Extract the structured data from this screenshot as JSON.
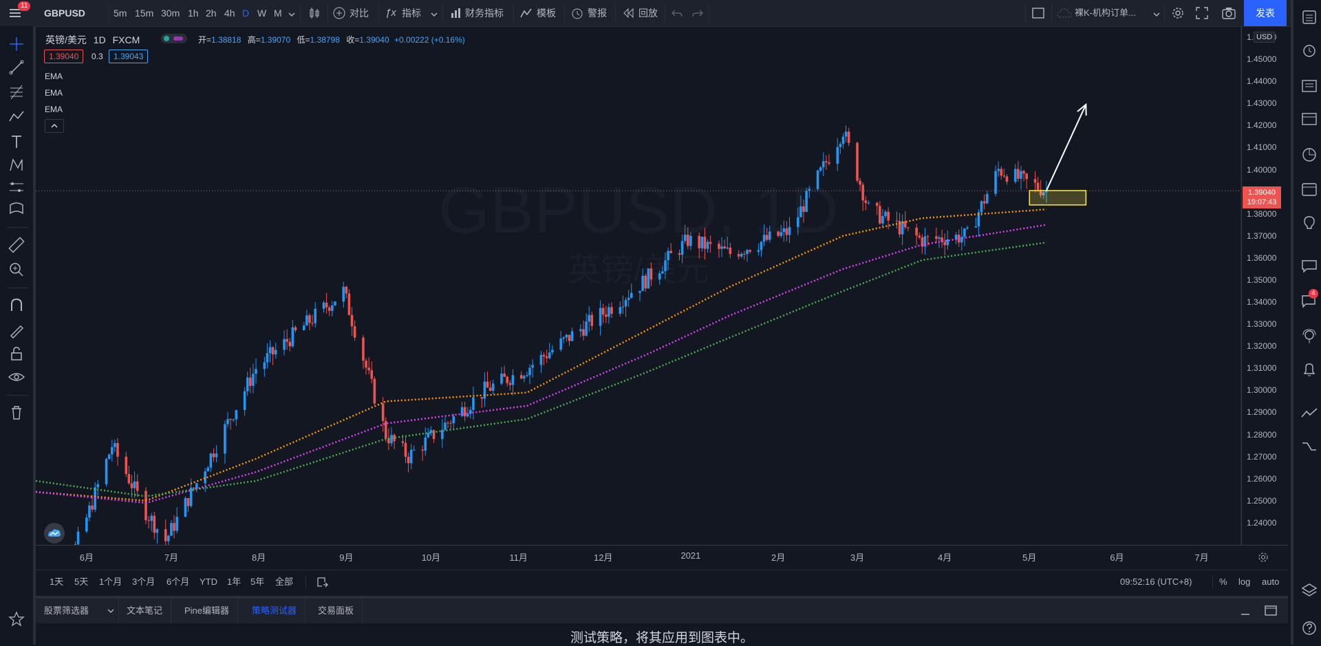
{
  "topbar": {
    "menu_badge": "11",
    "symbol": "GBPUSD",
    "timeframes": [
      "5m",
      "15m",
      "30m",
      "1h",
      "2h",
      "4h",
      "D",
      "W",
      "M"
    ],
    "active_timeframe": "D",
    "compare": "对比",
    "indicators": "指标",
    "financials": "财务指标",
    "templates": "模板",
    "alerts": "警报",
    "replay": "回放",
    "layout_name": "裸K-机构订单...",
    "publish": "发表"
  },
  "legend": {
    "title": "英镑/美元",
    "interval": "1D",
    "source": "FXCM",
    "open_label": "开=",
    "open": "1.38818",
    "high_label": "高=",
    "high": "1.39070",
    "low_label": "低=",
    "low": "1.38798",
    "close_label": "收=",
    "close": "1.39040",
    "change": "+0.00222 (+0.16%)",
    "bid": "1.39040",
    "spread": "0.3",
    "ask": "1.39043",
    "indicators": [
      "EMA",
      "EMA",
      "EMA"
    ]
  },
  "watermark": {
    "title": "GBPUSD, 1D",
    "subtitle": "英镑/美元"
  },
  "price_axis": {
    "currency": "USD",
    "labels": [
      "1.46000",
      "1.45000",
      "1.44000",
      "1.43000",
      "1.42000",
      "1.41000",
      "1.40000",
      "1.39000",
      "1.38000",
      "1.37000",
      "1.36000",
      "1.35000",
      "1.34000",
      "1.33000",
      "1.32000",
      "1.31000",
      "1.30000",
      "1.29000",
      "1.28000",
      "1.27000",
      "1.26000",
      "1.25000",
      "1.24000"
    ],
    "last_price": "1.39040",
    "countdown": "19:07:43"
  },
  "time_axis": {
    "labels": [
      "6月",
      "7月",
      "8月",
      "9月",
      "10月",
      "11月",
      "12月",
      "2021",
      "2月",
      "3月",
      "4月",
      "5月",
      "6月",
      "7月"
    ]
  },
  "rangebar": {
    "ranges": [
      "1天",
      "5天",
      "1个月",
      "3个月",
      "6个月",
      "YTD",
      "1年",
      "5年",
      "全部"
    ],
    "clock": "09:52:16 (UTC+8)",
    "percent": "%",
    "log": "log",
    "auto": "auto"
  },
  "bottom_tabs": {
    "tabs": [
      "股票筛选器",
      "文本笔记",
      "Pine编辑器",
      "策略测试器",
      "交易面板"
    ],
    "active": "策略测试器",
    "message": "测试策略，将其应用到图表中。"
  },
  "right_badge": "4",
  "colors": {
    "up": "#2196f3",
    "down": "#ef5350",
    "ema_fast": "#ff9800",
    "ema_mid": "#e040fb",
    "ema_slow": "#4caf50",
    "highlight": "#ffeb3b",
    "accent": "#2962ff"
  },
  "chart_data": {
    "type": "candlestick",
    "y_range": [
      1.23,
      1.465
    ],
    "date_range": [
      "2020-05-14",
      "2021-07-15"
    ],
    "price_samples": {
      "dates": [
        "2020-05-14",
        "2020-05-25",
        "2020-06-01",
        "2020-06-10",
        "2020-06-22",
        "2020-06-29",
        "2020-07-10",
        "2020-07-31",
        "2020-08-31",
        "2020-09-15",
        "2020-09-23",
        "2020-10-20",
        "2020-11-04",
        "2020-11-20",
        "2020-12-01",
        "2020-12-16",
        "2020-12-31",
        "2021-01-15",
        "2021-02-05",
        "2021-02-24",
        "2021-03-05",
        "2021-03-24",
        "2021-04-09",
        "2021-04-20",
        "2021-05-07"
      ],
      "close": [
        1.218,
        1.219,
        1.242,
        1.275,
        1.245,
        1.232,
        1.258,
        1.31,
        1.345,
        1.28,
        1.27,
        1.3,
        1.31,
        1.325,
        1.335,
        1.35,
        1.368,
        1.362,
        1.372,
        1.418,
        1.382,
        1.368,
        1.37,
        1.4,
        1.3904
      ]
    },
    "ema_fast": {
      "dates": [
        "2020-05-14",
        "2020-06-22",
        "2020-07-31",
        "2020-09-15",
        "2020-11-04",
        "2020-12-16",
        "2021-01-15",
        "2021-02-24",
        "2021-03-24",
        "2021-05-07"
      ],
      "values": [
        1.254,
        1.25,
        1.269,
        1.295,
        1.299,
        1.327,
        1.347,
        1.37,
        1.378,
        1.382
      ]
    },
    "ema_mid": {
      "dates": [
        "2020-05-14",
        "2020-06-22",
        "2020-07-31",
        "2020-09-15",
        "2020-11-04",
        "2020-12-16",
        "2021-01-15",
        "2021-02-24",
        "2021-03-24",
        "2021-05-07"
      ],
      "values": [
        1.254,
        1.249,
        1.263,
        1.285,
        1.293,
        1.316,
        1.334,
        1.355,
        1.366,
        1.375
      ]
    },
    "ema_slow": {
      "dates": [
        "2020-05-14",
        "2020-06-22",
        "2020-07-31",
        "2020-09-15",
        "2020-11-04",
        "2020-12-16",
        "2021-01-15",
        "2021-02-24",
        "2021-03-24",
        "2021-05-07"
      ],
      "values": [
        1.259,
        1.252,
        1.259,
        1.278,
        1.287,
        1.308,
        1.324,
        1.345,
        1.359,
        1.367
      ]
    },
    "highlight_box": {
      "date_start": "2021-05-01",
      "date_end": "2021-05-21",
      "price_top": 1.3905,
      "price_bottom": 1.384
    },
    "arrow": {
      "from": {
        "date": "2021-05-07",
        "price": 1.3905
      },
      "to": {
        "date": "2021-05-21",
        "price": 1.4295
      }
    }
  }
}
